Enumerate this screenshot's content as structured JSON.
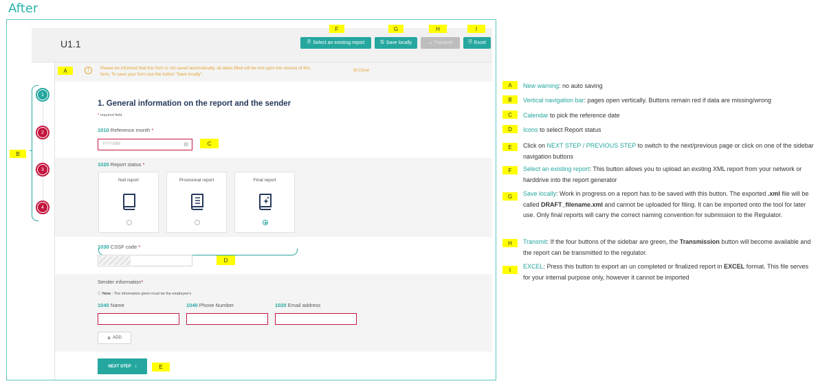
{
  "heading": "After",
  "form": {
    "id": "U1.1",
    "toolbar": {
      "select_report": "Select an existing report",
      "save_locally": "Save locally",
      "transmit": "Transmit",
      "excel": "Excel"
    },
    "annotation_tags": [
      "A",
      "B",
      "C",
      "D",
      "E",
      "F",
      "G",
      "H",
      "I"
    ],
    "warning": {
      "line1": "Please be informed that this form is not saved automatically, all datas filled will be lost upon the closure of this",
      "line2": "form. To save your form use the button \"Save locally\".",
      "close": "Close"
    },
    "nav_steps": [
      {
        "num": "1",
        "status": "complete",
        "color": "#25a79f"
      },
      {
        "num": "2",
        "status": "error",
        "color": "#c4163f"
      },
      {
        "num": "3",
        "status": "error",
        "color": "#c4163f"
      },
      {
        "num": "4",
        "status": "error",
        "color": "#c4163f"
      }
    ],
    "section_title": "1. General information on the report and the sender",
    "required_prefix": "*",
    "required_text": " required field",
    "reference_month": {
      "code": "1010",
      "label": " Reference month",
      "star": " *",
      "placeholder": "YYYYMM"
    },
    "report_status": {
      "code": "1020",
      "label": " Report status",
      "star": " *",
      "cards": [
        {
          "title": "Null report",
          "icon": "book-icon",
          "selected": false
        },
        {
          "title": "Provisional report",
          "icon": "book-text-icon",
          "selected": false
        },
        {
          "title": "Final report",
          "icon": "book-star-icon",
          "selected": true
        }
      ]
    },
    "cssf_code": {
      "code": "1030",
      "label": " CSSF code",
      "star": " *"
    },
    "sender": {
      "title": "Sender information",
      "star": "*",
      "note_bold": "Note",
      "note": " : The information given must be the employee's",
      "fields": [
        {
          "code": "1040",
          "label": " Name"
        },
        {
          "code": "1040",
          "label": " Phone Number"
        },
        {
          "code": "1020",
          "label": " Email address"
        }
      ],
      "add": "ADD"
    },
    "next_step": "NEXT STEP"
  },
  "legend": [
    {
      "tag": "A",
      "highlight": "New warning",
      "rest": ": no auto saving"
    },
    {
      "tag": "B",
      "highlight": "Vertical navigation bar",
      "rest": ": pages open vertically. Buttons remain red if data are missing/wrong"
    },
    {
      "tag": "C",
      "highlight": "Calendar",
      "rest": " to pick the reference date"
    },
    {
      "tag": "D",
      "highlight": "Icons",
      "rest": " to select Report status"
    },
    {
      "tag": "E",
      "pre": "Click on ",
      "highlight": "NEXT STEP / PREVIOUS STEP",
      "rest": " to switch to the next/previous page or click on one of the sidebar navigation buttons"
    },
    {
      "tag": "F",
      "highlight": "Select an existing report",
      "rest": ": This button allows you to upload an exsting XML report from your network or harddrive into the report generator"
    },
    {
      "tag": "G",
      "highlight": "Save locally",
      "rest_parts": [
        ": Work in progress on a report has to be saved with this button. The exported ",
        ".xml",
        " file will be called ",
        "DRAFT_filename.xml",
        " and cannot be uploaded for filing. It can be imported onto the tool for later use. Only final reports will carry the correct naming convention for submission to the Regulator."
      ]
    },
    {
      "tag": "H",
      "highlight": "Transmit",
      "rest_parts": [
        ": If the four buttons of the sidebar are green, the ",
        "Transmission",
        " button will become available and the report can be transmitted to the regulator."
      ]
    },
    {
      "tag": "I",
      "highlight": "EXCEL",
      "rest_parts": [
        ": Press this button to export an un completed or finalized report in ",
        "EXCEL",
        " format. This file serves for your internal purpose only, however it cannot be imported"
      ]
    }
  ]
}
